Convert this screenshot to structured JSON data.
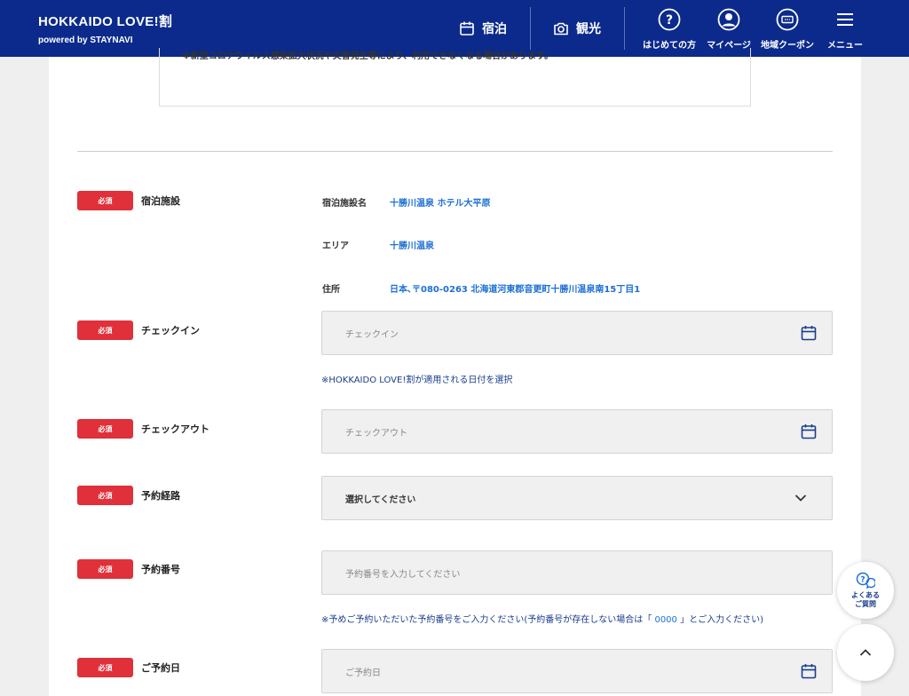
{
  "header": {
    "brand_title": "HOKKAIDO LOVE!割",
    "brand_sub": "powered by STAYNAVI",
    "nav_stay": "宿泊",
    "nav_sightseeing": "観光",
    "nav_first": "はじめての方",
    "nav_mypage": "マイページ",
    "nav_coupon": "地域クーポン",
    "nav_menu": "メニュー"
  },
  "notice": "※新型コロナウイルス感染拡大状況や災害発生等により、利用できなくなる場合があります。",
  "required_label": "必須",
  "accommodation": {
    "label": "宿泊施設",
    "name_key": "宿泊施設名",
    "name_value": "十勝川温泉 ホテル大平原",
    "area_key": "エリア",
    "area_value": "十勝川温泉",
    "address_key": "住所",
    "address_value": "日本､〒080-0263 北海道河東郡音更町十勝川温泉南15丁目1"
  },
  "checkin": {
    "label": "チェックイン",
    "placeholder": "チェックイン",
    "note": "※HOKKAIDO LOVE!割が適用される日付を選択"
  },
  "checkout": {
    "label": "チェックアウト",
    "placeholder": "チェックアウト"
  },
  "route": {
    "label": "予約経路",
    "value": "選択してください"
  },
  "reservation_number": {
    "label": "予約番号",
    "placeholder": "予約番号を入力してください",
    "note_prefix": "※予めご予約いただいた予約番号をご入力ください(予約番号が存在しない場合は「",
    "note_code": " 0000 ",
    "note_suffix": "」とご入力ください)"
  },
  "reservation_date": {
    "label": "ご予約日",
    "placeholder": "ご予約日"
  },
  "faq": {
    "line1": "よくある",
    "line2": "ご質問"
  },
  "colors": {
    "header_bg": "#0b2a8c",
    "required_bg": "#e0303a",
    "link_blue": "#1d6fd6"
  }
}
